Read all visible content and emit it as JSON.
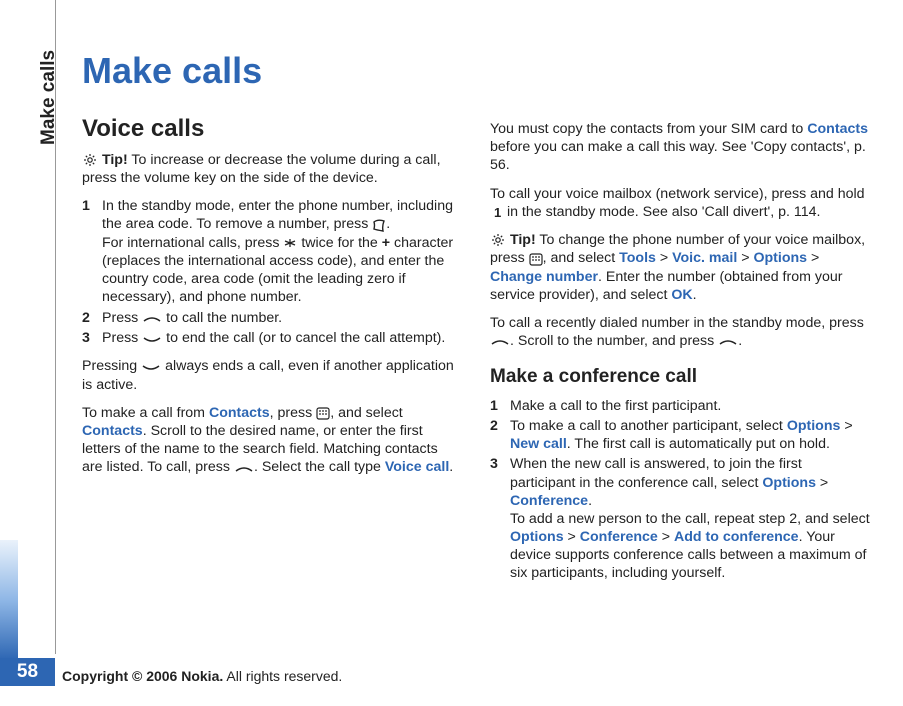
{
  "sideTab": "Make calls",
  "pageNumber": "58",
  "footer": {
    "bold": "Copyright © 2006 Nokia.",
    "rest": " All rights reserved."
  },
  "title": "Make calls",
  "col1": {
    "h2": "Voice calls",
    "tip1_a": "Tip!",
    "tip1_b": " To increase or decrease the volume during a call, press the volume key on the side of the device.",
    "step1_a": "In the standby mode, enter the phone number, including the area code. To remove a number, press ",
    "step1_b": ".",
    "step1_c": "For international calls, press ",
    "step1_d": " twice for the ",
    "step1_plus": "+",
    "step1_e": " character (replaces the international access code), and enter the country code, area code (omit the leading zero if necessary), and phone number.",
    "step2_a": "Press ",
    "step2_b": " to call the number.",
    "step3_a": "Press ",
    "step3_b": " to end the call (or to cancel the call attempt).",
    "p_after_a": "Pressing ",
    "p_after_b": " always ends a call, even if another application is active.",
    "p_contacts_a": "To make a call from ",
    "p_contacts_b": "Contacts",
    "p_contacts_c": ", press ",
    "p_contacts_d": ", and select ",
    "p_contacts_e": "Contacts",
    "p_contacts_f": ". Scroll to the desired name, or enter the first letters of the name to the search field. Matching contacts are listed. To call, press ",
    "p_contacts_g": ". Select the call type ",
    "p_contacts_h": "Voice call",
    "p_contacts_i": "."
  },
  "col2": {
    "p_sim_a": "You must copy the contacts from your SIM card to ",
    "p_sim_b": "Contacts",
    "p_sim_c": " before you can make a call this way. See 'Copy contacts', p. 56.",
    "p_mail_a": "To call your voice mailbox (network service), press and hold ",
    "p_mail_b": " in the standby mode. See also 'Call divert', p. 114.",
    "tip2_a": "Tip!",
    "tip2_b": " To change the phone number of your voice mailbox, press ",
    "tip2_c": ", and select ",
    "tip2_tools": "Tools",
    "tip2_gt1": " > ",
    "tip2_voic": "Voic. mail",
    "tip2_gt2": " > ",
    "tip2_opt": "Options",
    "tip2_gt3": " > ",
    "tip2_chg": "Change number",
    "tip2_d": ". Enter the number (obtained from your service provider), and select ",
    "tip2_ok": "OK",
    "tip2_e": ".",
    "p_recent_a": "To call a recently dialed number in the standby mode, press ",
    "p_recent_b": ". Scroll to the number, and press ",
    "p_recent_c": ".",
    "h3": "Make a conference call",
    "cstep1": "Make a call to the first participant.",
    "cstep2_a": "To make a call to another participant, select ",
    "cstep2_opt": "Options",
    "cstep2_gt": " > ",
    "cstep2_new": "New call",
    "cstep2_b": ". The first call is automatically put on hold.",
    "cstep3_a": "When the new call is answered, to join the first participant in the conference call, select ",
    "cstep3_opt": "Options",
    "cstep3_gt": " > ",
    "cstep3_conf": "Conference",
    "cstep3_b": ".",
    "cstep3_c": "To add a new person to the call, repeat step 2, and select ",
    "cstep3_opt2": "Options",
    "cstep3_gt2": " > ",
    "cstep3_conf2": "Conference",
    "cstep3_gt3": " > ",
    "cstep3_add": "Add to conference",
    "cstep3_d": ". Your device supports conference calls between a maximum of six participants, including yourself."
  },
  "nums": {
    "n1": "1",
    "n2": "2",
    "n3": "3"
  }
}
